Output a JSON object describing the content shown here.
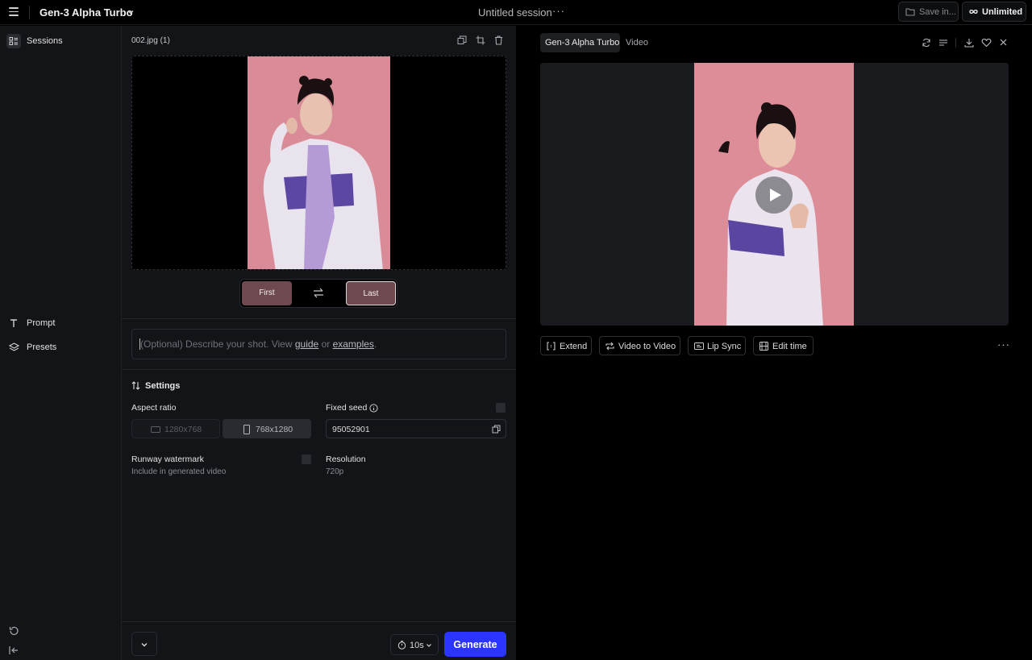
{
  "topbar": {
    "model_title": "Gen-3 Alpha Turbo",
    "session_title": "Untitled session",
    "session_more": "···",
    "save_label": "Save in...",
    "plan_label": "Unlimited"
  },
  "sidebar": {
    "items": [
      {
        "label": "Sessions",
        "icon": "sessions-icon"
      },
      {
        "label": "Prompt",
        "icon": "text-icon"
      },
      {
        "label": "Presets",
        "icon": "layers-icon"
      }
    ]
  },
  "editor": {
    "file_name": "002.jpg (1)",
    "frames": {
      "first": "First",
      "last": "Last"
    },
    "prompt": {
      "pre": "(Optional) Describe your shot. View ",
      "guide": "guide",
      "mid": " or ",
      "examples": "examples",
      "post": "."
    },
    "settings_title": "Settings",
    "aspect_ratio_label": "Aspect ratio",
    "aspect_options": [
      "1280x768",
      "768x1280"
    ],
    "aspect_selected": "768x1280",
    "fixed_seed_label": "Fixed seed",
    "seed_value": "95052901",
    "watermark_label": "Runway watermark",
    "watermark_sub": "Include in generated video",
    "resolution_label": "Resolution",
    "resolution_value": "720p",
    "duration": "10s",
    "generate_label": "Generate"
  },
  "output": {
    "tabs": [
      "Gen-3 Alpha Turbo",
      "Video"
    ],
    "actions": [
      "Extend",
      "Video to Video",
      "Lip Sync",
      "Edit time"
    ],
    "more": "···"
  },
  "colors": {
    "accent": "#2b35ff",
    "photo_background": "#d68d97",
    "panel": "#131417"
  }
}
